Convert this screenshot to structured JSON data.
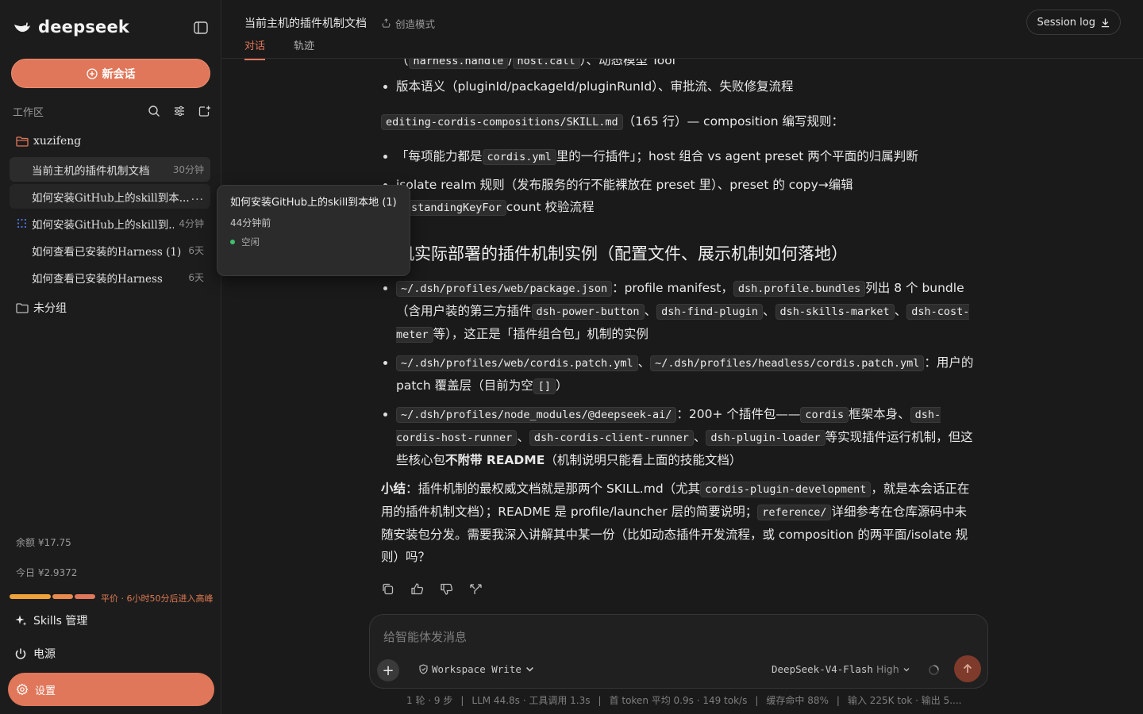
{
  "brand": {
    "name": "deepseek"
  },
  "new_chat_label": "新会话",
  "workspace": {
    "label": "工作区"
  },
  "folders": {
    "user": "xuzifeng",
    "ungrouped": "未分组"
  },
  "conversations": [
    {
      "title": "当前主机的插件机制文档",
      "time": "30分钟"
    },
    {
      "title": "如何安装GitHub上的skill到本...",
      "time": "..."
    },
    {
      "title": "如何安装GitHub上的skill到...",
      "time": "4分钟"
    },
    {
      "title": "如何查看已安装的Harness (1)",
      "time": "6天"
    },
    {
      "title": "如何查看已安装的Harness",
      "time": "6天"
    }
  ],
  "tooltip": {
    "title": "如何安装GitHub上的skill到本地 (1)",
    "time": "44分钟前",
    "status": "空闲"
  },
  "balance": {
    "remaining": "余额 ¥17.75",
    "today": "今日 ¥2.9372",
    "peak_note": "平价 · 6小时50分后进入高峰"
  },
  "usage_level": 0.62,
  "side_actions": {
    "skills": "Skills 管理",
    "power": "电源",
    "settings": "设置"
  },
  "header": {
    "doc_title": "当前主机的插件机制文档",
    "mode": "创造模式",
    "tabs": [
      "对话",
      "轨迹"
    ],
    "session_log": "Session log"
  },
  "article": {
    "top_fragment_pre": "（",
    "top_code1": "harness.handle",
    "top_slash": "/",
    "top_code2": "host.call",
    "top_fragment_post": "）、动态模型 Tool",
    "bullet0": "版本语义（pluginId/packageId/pluginRunId）、审批流、失败修复流程",
    "p1_code": "editing-cordis-compositions/SKILL.md",
    "p1_text": "（165 行）— composition 编写规则：",
    "b1_pre": "「每项能力都是",
    "b1_code": "cordis.yml",
    "b1_post": "里的一行插件」；host 组合 vs agent preset 两个平面的归属判断",
    "b2_pre": "isolate realm 规则（发布服务的行不能裸放在 preset 里）、preset 的 copy→编辑→",
    "b2_code": "standingKeyFor",
    "b2_post": "count 校验流程",
    "heading": "本机实际部署的插件机制实例（配置文件、展示机制如何落地）",
    "c1_code1": "~/.dsh/profiles/web/package.json",
    "c1_t1": "：profile manifest，",
    "c1_code2": "dsh.profile.bundles",
    "c1_t2": "列出 8 个 bundle（含用户装的第三方插件",
    "c1_code3": "dsh-power-button",
    "c1_sep1": "、",
    "c1_code4": "dsh-find-plugin",
    "c1_sep2": "、",
    "c1_code5": "dsh-skills-market",
    "c1_sep3": "、",
    "c1_code6": "dsh-cost-meter",
    "c1_t3": "等），这正是「插件组合包」机制的实例",
    "c2_code1": "~/.dsh/profiles/web/cordis.patch.yml",
    "c2_sep": "、",
    "c2_code2": "~/.dsh/profiles/headless/cordis.patch.yml",
    "c2_t1": "：用户的 patch 覆盖层（目前为空",
    "c2_code3": "[]",
    "c2_t2": "）",
    "c3_code1": "~/.dsh/profiles/node_modules/@deepseek-ai/",
    "c3_t1": "：200+ 个插件包——",
    "c3_code2": "cordis",
    "c3_t2": "框架本身、",
    "c3_code3": "dsh-cordis-host-runner",
    "c3_sep1": "、",
    "c3_code4": "dsh-cordis-client-runner",
    "c3_sep2": "、",
    "c3_code5": "dsh-plugin-loader",
    "c3_t3": "等实现插件运行机制，但这些核心包",
    "c3_bold": "不附带 README",
    "c3_t4": "（机制说明只能看上面的技能文档）",
    "s_bold": "小结",
    "s_t1": "：插件机制的最权威文档就是那两个 SKILL.md（尤其",
    "s_code1": "cordis-plugin-development",
    "s_t2": "，就是本会话正在用的插件机制文档）；README 是 profile/launcher 层的简要说明；",
    "s_code2": "reference/",
    "s_t3": "详细参考在仓库源码中未随安装包分发。需要我深入讲解其中某一份（比如动态插件开发流程，或 composition 的两平面/isolate 规则）吗？"
  },
  "composer": {
    "placeholder": "给智能体发消息",
    "permission": "Workspace Write",
    "model": "DeepSeek-V4-Flash",
    "effort": "High"
  },
  "stats": {
    "turns": "1 轮 · 9 步",
    "llm": "LLM 44.8s · 工具调用 1.3s",
    "token": "首 token 平均 0.9s · 149 tok/s",
    "cache": "缓存命中 88%",
    "io": "输入 225K tok · 输出 5...."
  },
  "colors": {
    "accent": "#e0775a",
    "background": "#1a1a1a",
    "sidebar": "#1c1c1c",
    "status_idle": "#3ec26b"
  }
}
